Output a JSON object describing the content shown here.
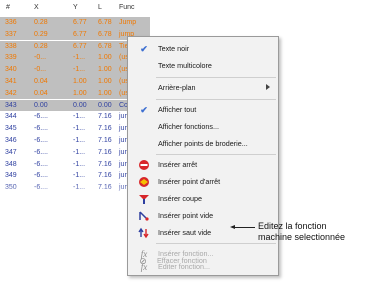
{
  "grid": {
    "headers": [
      "#",
      "X",
      "Y",
      "L",
      "Func"
    ],
    "rows": [
      {
        "n": "336",
        "x": "0.28",
        "y": "6.77",
        "l": "6.78",
        "f": "Jump",
        "style": "sel-orange"
      },
      {
        "n": "337",
        "x": "0.29",
        "y": "6.77",
        "l": "6.78",
        "f": "jump",
        "style": "sel-orange"
      },
      {
        "n": "338",
        "x": "0.28",
        "y": "6.77",
        "l": "6.78",
        "f": "TieOf",
        "style": "sel-orange"
      },
      {
        "n": "339",
        "x": "-0...",
        "y": "-1...",
        "l": "1.00",
        "f": "(user",
        "style": "sel-orange"
      },
      {
        "n": "340",
        "x": "-0...",
        "y": "-1...",
        "l": "1.00",
        "f": "(user",
        "style": "sel-orange"
      },
      {
        "n": "341",
        "x": "0.04",
        "y": "1.00",
        "l": "1.00",
        "f": "(user",
        "style": "sel-orange"
      },
      {
        "n": "342",
        "x": "0.04",
        "y": "1.00",
        "l": "1.00",
        "f": "(user",
        "style": "sel-orange"
      },
      {
        "n": "343",
        "x": "0.00",
        "y": "0.00",
        "l": "0.00",
        "f": "Color",
        "style": "sel-blue"
      },
      {
        "n": "344",
        "x": "-6....",
        "y": "-1...",
        "l": "7.16",
        "f": "jump",
        "style": "blue"
      },
      {
        "n": "345",
        "x": "-6....",
        "y": "-1...",
        "l": "7.16",
        "f": "jump",
        "style": "blue"
      },
      {
        "n": "346",
        "x": "-6....",
        "y": "-1...",
        "l": "7.16",
        "f": "jump",
        "style": "blue"
      },
      {
        "n": "347",
        "x": "-6....",
        "y": "-1...",
        "l": "7.16",
        "f": "jump",
        "style": "blue"
      },
      {
        "n": "348",
        "x": "-6....",
        "y": "-1...",
        "l": "7.16",
        "f": "jump",
        "style": "blue"
      },
      {
        "n": "349",
        "x": "-6....",
        "y": "-1...",
        "l": "7.16",
        "f": "jump",
        "style": "blue"
      },
      {
        "n": "350",
        "x": "-6....",
        "y": "-1...",
        "l": "7.16",
        "f": "jump",
        "style": "blue"
      }
    ]
  },
  "menu": {
    "items": [
      {
        "label": "Texte noir",
        "icon": "check-icon",
        "checked": true,
        "disabled": false
      },
      {
        "label": "Texte multicolore",
        "icon": "",
        "checked": false,
        "disabled": false
      },
      {
        "label": "Arrière-plan",
        "icon": "",
        "checked": false,
        "disabled": false,
        "submenu": true
      },
      {
        "label": "Afficher tout",
        "icon": "check-icon",
        "checked": true,
        "disabled": false
      },
      {
        "label": "Afficher fonctions...",
        "icon": "",
        "checked": false,
        "disabled": false
      },
      {
        "label": "Afficher points de broderie...",
        "icon": "",
        "checked": false,
        "disabled": false
      },
      {
        "label": "Insérer arrêt",
        "icon": "stop-icon",
        "disabled": false
      },
      {
        "label": "Insérer point d'arrêt",
        "icon": "stop-point-icon",
        "disabled": false
      },
      {
        "label": "Insérer coupe",
        "icon": "trim-icon",
        "disabled": false
      },
      {
        "label": "Insérer point vide",
        "icon": "empty-stitch-icon",
        "disabled": false
      },
      {
        "label": "Insérer saut vide",
        "icon": "empty-jump-icon",
        "disabled": false
      },
      {
        "label": "Insérer fonction...",
        "icon": "function-icon",
        "disabled": true
      },
      {
        "label": "Editer fonction...",
        "icon": "edit-function-icon",
        "disabled": true
      },
      {
        "label": "Effacer fonction",
        "icon": "delete-function-icon",
        "disabled": true
      }
    ]
  },
  "callout": {
    "text": "Editez la fonction machine selectionnée"
  },
  "colors": {
    "orange": "#f07800",
    "blue": "#2e3fa0",
    "selection": "#bfbfbf",
    "menu_bg": "#f2f2f2",
    "check": "#3d6fd1"
  }
}
